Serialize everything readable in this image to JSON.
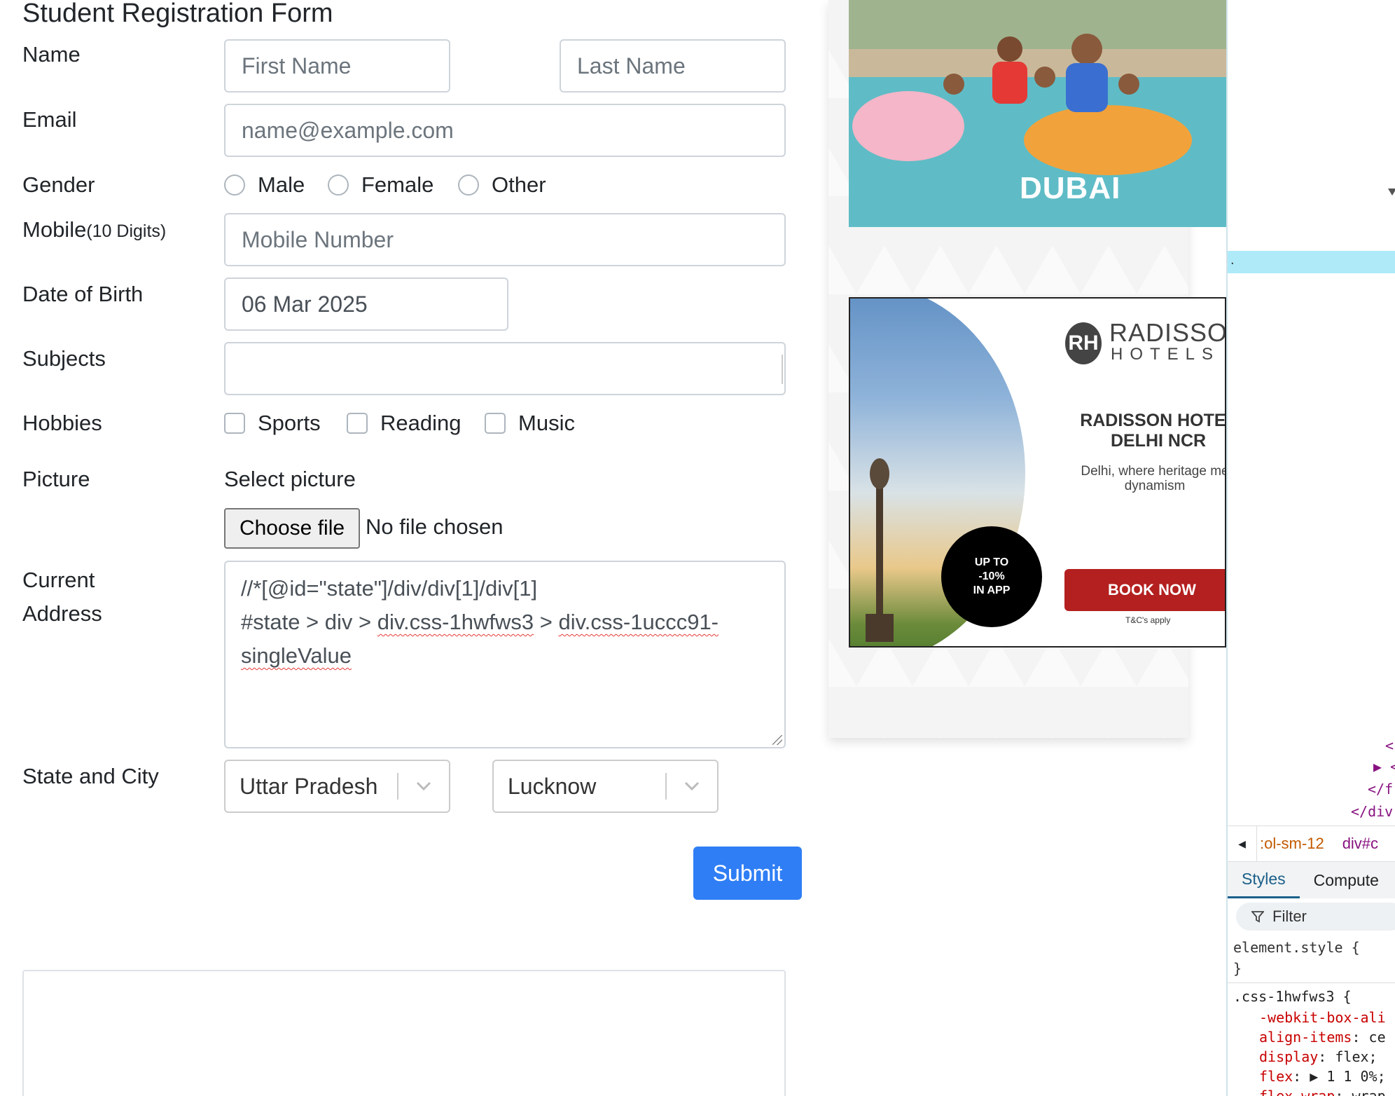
{
  "form": {
    "title": "Student Registration Form",
    "name_label": "Name",
    "first_name_placeholder": "First Name",
    "last_name_placeholder": "Last Name",
    "email_label": "Email",
    "email_placeholder": "name@example.com",
    "gender_label": "Gender",
    "gender_options": [
      "Male",
      "Female",
      "Other"
    ],
    "mobile_label": "Mobile",
    "mobile_suffix": "(10 Digits)",
    "mobile_placeholder": "Mobile Number",
    "dob_label": "Date of Birth",
    "dob_value": "06 Mar 2025",
    "subjects_label": "Subjects",
    "hobbies_label": "Hobbies",
    "hobbies_options": [
      "Sports",
      "Reading",
      "Music"
    ],
    "picture_label": "Picture",
    "picture_select_text": "Select picture",
    "choose_file_label": "Choose file",
    "no_file_text": "No file chosen",
    "address_label_line1": "Current",
    "address_label_line2": "Address",
    "address_lines": {
      "line1": "//*[@id=\"state\"]/div/div[1]/div[1]",
      "line2_prefix": "#state > div > ",
      "line2_word1": "div.css-1hwfws3",
      "line2_mid": " > ",
      "line2_word2": "div.css-1uccc91-",
      "line3": "singleValue"
    },
    "state_city_label": "State and City",
    "state_value": "Uttar Pradesh",
    "city_value": "Lucknow",
    "submit_label": "Submit"
  },
  "ads": {
    "dubai_text": "DUBAI",
    "radisson_brand": "RADISSON",
    "radisson_sub": "HOTELS",
    "radisson_logo": "RH",
    "radisson_title_line1": "RADISSON HOTEL",
    "radisson_title_line2": "DELHI NCR",
    "radisson_desc_line1": "Delhi, where heritage me",
    "radisson_desc_line2": "dynamism",
    "badge_line1": "UP TO",
    "badge_line2": "-10%",
    "badge_line3": "IN APP",
    "book_now": "BOOK NOW",
    "tc": "T&C's apply"
  },
  "devtools": {
    "code_lines": [
      "<",
      "▶ <",
      "</f",
      "</div"
    ],
    "breadcrumb_1": ":ol-sm-12",
    "breadcrumb_2": "div#c",
    "tab_styles": "Styles",
    "tab_computed": "Compute",
    "filter_label": "Filter",
    "style_lines": {
      "element_style": "element.style {",
      "close": "}",
      "selector": ".css-1hwfws3 {",
      "p1_name": "-webkit-box-ali",
      "p2_name": "align-items",
      "p2_val": "ce",
      "p3_name": "display",
      "p3_val": "flex;",
      "p4_name": "flex",
      "p4_val": "1 1 0%;",
      "p5_name": "flex-wrap",
      "p5_val": "wrap"
    }
  },
  "colors": {
    "primary": "#2f7ef5",
    "radisson_red": "#b3201f",
    "devtools_highlight": "#aeeaf8",
    "devtools_tag": "#881280",
    "css_property": "#c80000"
  }
}
